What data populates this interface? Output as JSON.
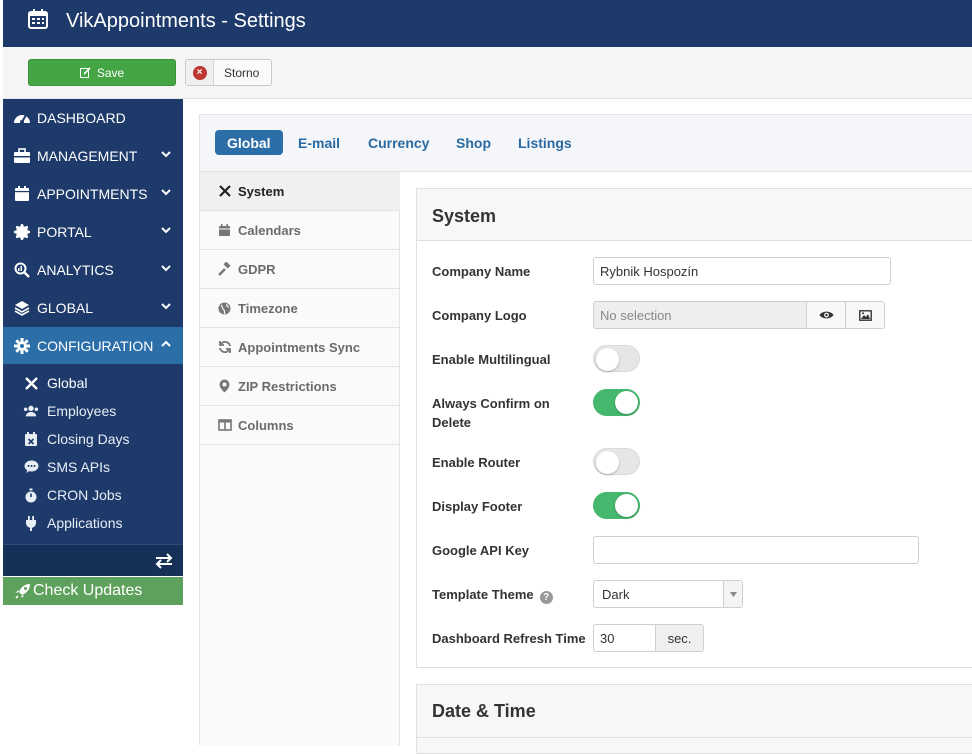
{
  "app": {
    "title": "VikAppointments - Settings"
  },
  "toolbar": {
    "save_label": "Save",
    "cancel_label": "Storno"
  },
  "sidebar": {
    "items": [
      {
        "label": "DASHBOARD",
        "icon": "dashboard-icon"
      },
      {
        "label": "MANAGEMENT",
        "icon": "briefcase-icon"
      },
      {
        "label": "APPOINTMENTS",
        "icon": "calendar-icon"
      },
      {
        "label": "PORTAL",
        "icon": "badge-icon"
      },
      {
        "label": "ANALYTICS",
        "icon": "search-chart-icon"
      },
      {
        "label": "GLOBAL",
        "icon": "layers-icon"
      },
      {
        "label": "CONFIGURATION",
        "icon": "gear-icon"
      }
    ],
    "subitems": [
      {
        "label": "Global",
        "icon": "tools-icon"
      },
      {
        "label": "Employees",
        "icon": "users-icon"
      },
      {
        "label": "Closing Days",
        "icon": "calendar-x-icon"
      },
      {
        "label": "SMS APIs",
        "icon": "sms-icon"
      },
      {
        "label": "CRON Jobs",
        "icon": "stopwatch-icon"
      },
      {
        "label": "Applications",
        "icon": "plug-icon"
      }
    ],
    "check_updates": "Check Updates"
  },
  "tabs": [
    "Global",
    "E-mail",
    "Currency",
    "Shop",
    "Listings"
  ],
  "subnav": [
    "System",
    "Calendars",
    "GDPR",
    "Timezone",
    "Appointments Sync",
    "ZIP Restrictions",
    "Columns"
  ],
  "system": {
    "title": "System",
    "company_name_label": "Company Name",
    "company_name_value": "Rybnik Hospozín",
    "company_logo_label": "Company Logo",
    "company_logo_value": "No selection",
    "multilingual_label": "Enable Multilingual",
    "multilingual_on": false,
    "confirm_delete_label": "Always Confirm on Delete",
    "confirm_delete_on": true,
    "router_label": "Enable Router",
    "router_on": false,
    "footer_label": "Display Footer",
    "footer_on": true,
    "google_api_label": "Google API Key",
    "google_api_value": "",
    "theme_label": "Template Theme",
    "theme_value": "Dark",
    "refresh_label": "Dashboard Refresh Time",
    "refresh_value": "30",
    "refresh_unit": "sec."
  },
  "datetime": {
    "title": "Date & Time"
  },
  "colors": {
    "header": "#1e3a6a",
    "accent": "#2c6fa8",
    "save": "#44a544",
    "toggle_on": "#45b86d",
    "updates": "#5ea15c"
  }
}
